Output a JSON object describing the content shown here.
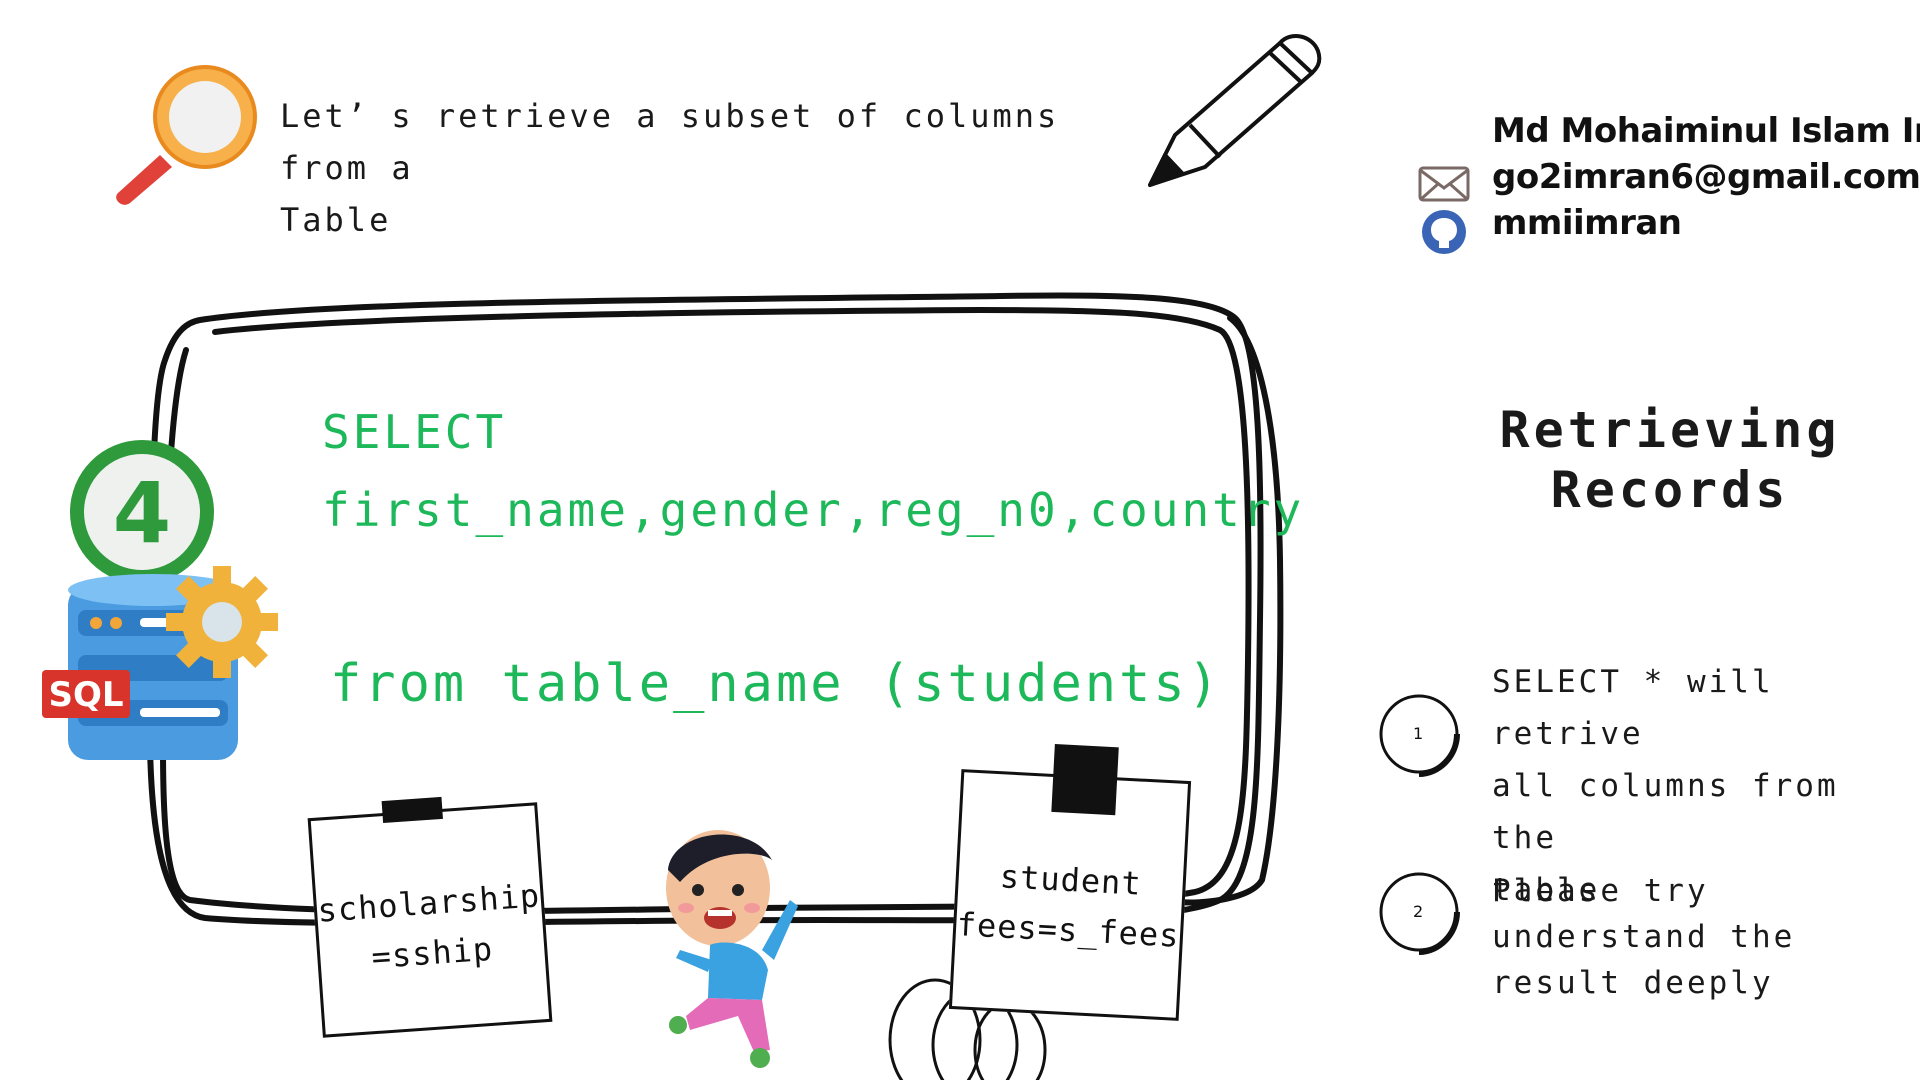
{
  "intro": {
    "line1": "Let’ s retrieve a subset of columns from a",
    "line2": "Table"
  },
  "author": {
    "name": "Md Mohaiminul Islam Imran",
    "email": "go2imran6@gmail.com",
    "github": "mmiimran"
  },
  "side_title": {
    "line1": "Retrieving",
    "line2": "Records"
  },
  "code": {
    "line1": "SELECT",
    "line2": "first_name,gender,reg_n0,country",
    "line3": "from table_name (students)"
  },
  "notes": {
    "left": {
      "line1": "scholarship",
      "line2": "=sship"
    },
    "right": {
      "line1": "student",
      "line2": "fees=s_fees"
    }
  },
  "badge": {
    "number": "4",
    "sql_label": "SQL"
  },
  "steps": [
    {
      "num": "1",
      "lines": [
        "SELECT * will retrive",
        "all columns from the",
        "table"
      ]
    },
    {
      "num": "2",
      "lines": [
        "Please try understand the",
        "result deeply"
      ]
    }
  ],
  "colors": {
    "code_green": "#1cb85a",
    "ink": "#111111",
    "magnifier_orange": "#f39a2a",
    "sql_red": "#d9342b"
  },
  "icons": [
    "magnifier-icon",
    "pencil-icon",
    "mail-icon",
    "github-icon",
    "database-icon",
    "gear-icon",
    "number-badge-icon"
  ]
}
